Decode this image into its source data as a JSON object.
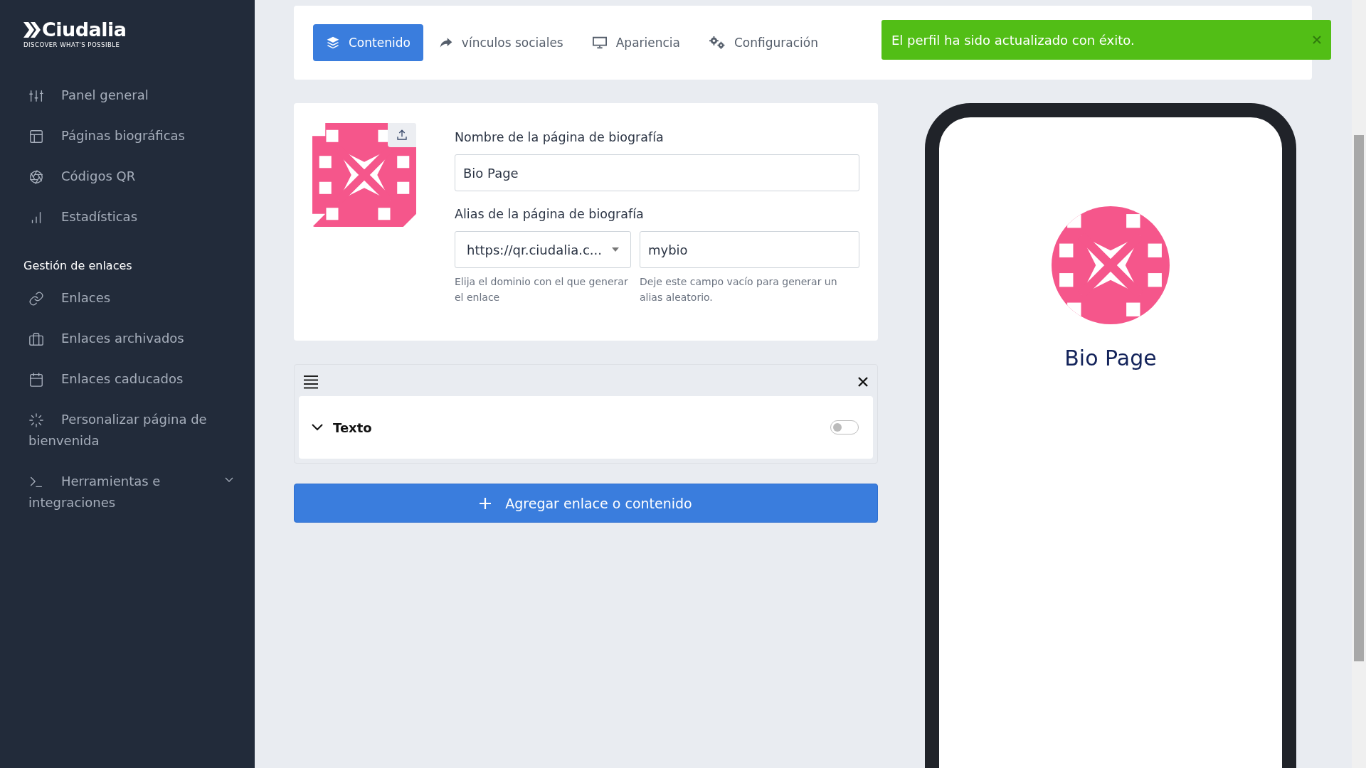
{
  "sidebar": {
    "logo": {
      "name": "Ciudalia",
      "tagline": "DISCOVER WHAT'S POSSIBLE"
    },
    "items": [
      {
        "label": "Panel general"
      },
      {
        "label": "Páginas biográficas"
      },
      {
        "label": "Códigos QR"
      },
      {
        "label": "Estadísticas"
      }
    ],
    "section_title": "Gestión de enlaces",
    "section_items": [
      {
        "label": "Enlaces"
      },
      {
        "label": "Enlaces archivados"
      },
      {
        "label": "Enlaces caducados"
      },
      {
        "label": "Personalizar página de bienvenida"
      },
      {
        "label": "Herramientas e integraciones"
      }
    ]
  },
  "tabs": [
    {
      "label": "Contenido",
      "selected": true
    },
    {
      "label": "vínculos sociales",
      "selected": false
    },
    {
      "label": "Apariencia",
      "selected": false
    },
    {
      "label": "Configuración",
      "selected": false
    }
  ],
  "toast": {
    "message": "El perfil ha sido actualizado con éxito."
  },
  "profile": {
    "name_label": "Nombre de la página de biografía",
    "name_value": "Bio Page",
    "alias_label": "Alias de la página de biografía",
    "domain_value": "https://qr.ciudalia.c...",
    "domain_help": "Elija el dominio con el que generar el enlace",
    "alias_value": "mybio",
    "alias_help": "Deje este campo vacío para generar un alias aleatorio."
  },
  "blocks": [
    {
      "title": "Texto",
      "expanded": true,
      "on": false
    }
  ],
  "add_button": {
    "label": "Agregar enlace o contenido"
  },
  "preview": {
    "title": "Bio Page"
  }
}
